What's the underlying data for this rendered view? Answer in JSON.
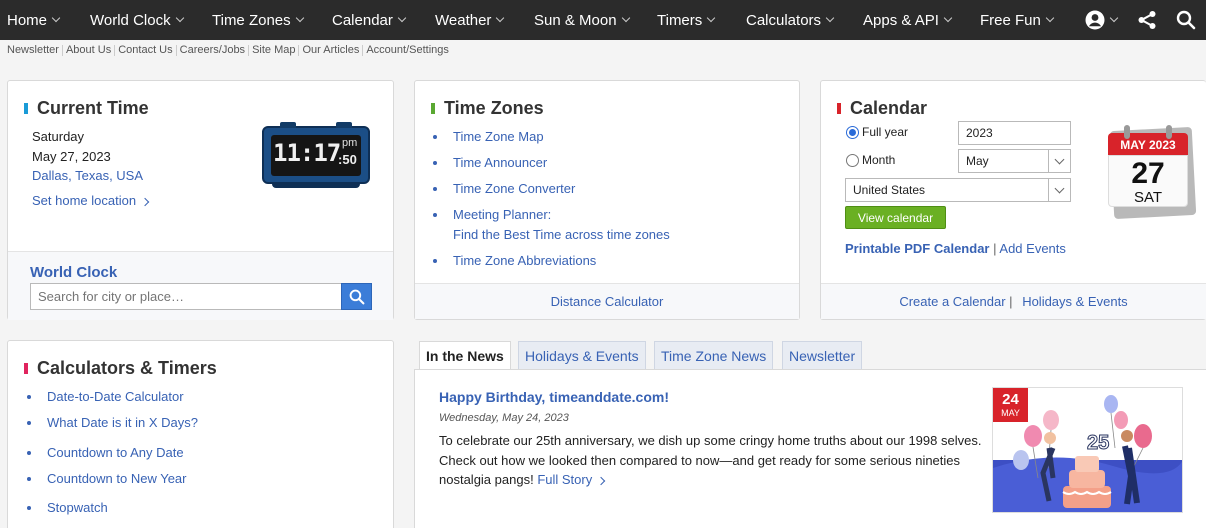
{
  "nav": {
    "items": [
      "Home",
      "World Clock",
      "Time Zones",
      "Calendar",
      "Weather",
      "Sun & Moon",
      "Timers",
      "Calculators",
      "Apps & API",
      "Free Fun"
    ]
  },
  "subnav": {
    "items": [
      "Newsletter",
      "About Us",
      "Contact Us",
      "Careers/Jobs",
      "Site Map",
      "Our Articles",
      "Account/Settings"
    ]
  },
  "current_time": {
    "title": "Current Time",
    "day": "Saturday",
    "date": "May 27, 2023",
    "location": "Dallas, Texas, USA",
    "set_home": "Set home location",
    "clock_time": "11:17",
    "clock_ampm": "pm",
    "clock_seconds": "50",
    "world_clock_title": "World Clock",
    "search_placeholder": "Search for city or place…"
  },
  "time_zones": {
    "title": "Time Zones",
    "links": [
      "Time Zone Map",
      "Time Announcer",
      "Time Zone Converter",
      "Meeting Planner:",
      "Time Zone Abbreviations"
    ],
    "meeting_sub": "Find the Best Time across time zones",
    "footer": "Distance Calculator"
  },
  "calendar": {
    "title": "Calendar",
    "full_year_label": "Full year",
    "month_label": "Month",
    "year_value": "2023",
    "month_value": "May",
    "country_value": "United States",
    "view_button": "View calendar",
    "printable": "Printable PDF Calendar",
    "sep": "|",
    "add_events": "Add Events",
    "icon_month": "MAY",
    "icon_year": "2023",
    "icon_day": "27",
    "icon_weekday": "SAT",
    "footer_create": "Create a Calendar",
    "footer_holidays": "Holidays & Events"
  },
  "calculators": {
    "title": "Calculators & Timers",
    "links": [
      "Date-to-Date Calculator",
      "What Date is it in X Days?",
      "Countdown to Any Date",
      "Countdown to New Year",
      "Stopwatch"
    ]
  },
  "news": {
    "tabs": [
      "In the News",
      "Holidays & Events",
      "Time Zone News",
      "Newsletter"
    ],
    "headline": "Happy Birthday, timeanddate.com!",
    "date": "Wednesday, May 24, 2023",
    "body": [
      "To celebrate our 25th anniversary, we dish up some cringy home truths about our 1998 selves.",
      "Check out how we looked then compared to now—and get ready for some serious nineties",
      "nostalgia pangs!"
    ],
    "full_story": "Full Story",
    "img_day": "24",
    "img_month": "MAY",
    "img_number": "25"
  },
  "colors": {
    "nav_bg": "#2b2b2b",
    "link": "#3862b4",
    "current_time_accent": "#1a9bd7",
    "time_zones_accent": "#5aa832",
    "calendar_accent": "#d8232a",
    "calculators_accent": "#e0245e",
    "view_button": "#6ab023"
  }
}
